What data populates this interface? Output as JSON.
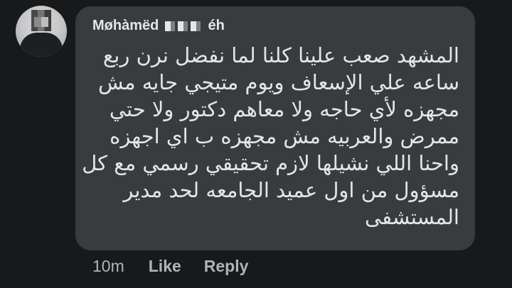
{
  "comment": {
    "author_visible_prefix": "Møhàmëd",
    "author_visible_suffix": "éh",
    "text_lines": [
      "المشهد صعب علينا كلنا لما نفضل نرن ربع",
      "ساعه علي الإسعاف ويوم متيجي جايه مش",
      "مجهزه لأي حاجه ولا معاهم دكتور ولا حتي",
      "ممرض والعربيه مش مجهزه ب اي اجهزه",
      "واحنا اللي نشيلها لازم تحقيقي رسمي مع كل",
      "مسؤول من اول عميد الجامعه لحد مدير",
      "المستشفى"
    ]
  },
  "actions": {
    "time": "10m",
    "like_label": "Like",
    "reply_label": "Reply"
  },
  "colors": {
    "background": "#18191a",
    "bubble": "#3a3b3c",
    "text": "#e4e6eb",
    "secondary": "#b0b3b8"
  }
}
